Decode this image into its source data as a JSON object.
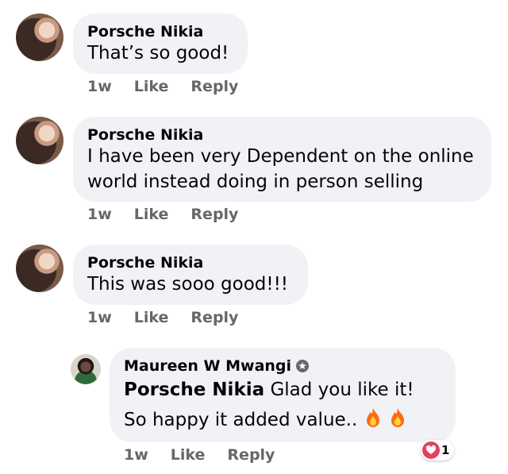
{
  "comments": [
    {
      "author": "Porsche Nikia",
      "text": "That’s so good!",
      "time": "1w",
      "like": "Like",
      "reply": "Reply"
    },
    {
      "author": "Porsche Nikia",
      "text": "I have been very Dependent on the online world instead doing in person selling",
      "time": "1w",
      "like": "Like",
      "reply": "Reply"
    },
    {
      "author": "Porsche Nikia",
      "text": "This was sooo good!!!",
      "time": "1w",
      "like": "Like",
      "reply": "Reply"
    }
  ],
  "reply_comment": {
    "author": "Maureen W Mwangi",
    "mention": "Porsche Nikia",
    "text": "Glad you like it! So happy it added value..",
    "emoji": [
      "fire",
      "fire"
    ],
    "time": "1w",
    "like": "Like",
    "reply": "Reply",
    "reaction": {
      "icon": "heart-reaction-icon",
      "count": "1"
    }
  }
}
